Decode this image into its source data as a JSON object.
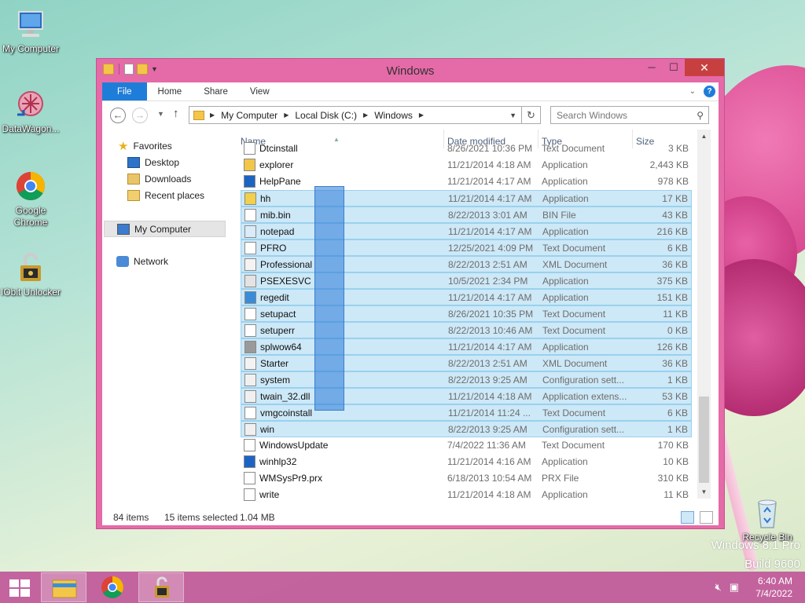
{
  "desktop": {
    "icons": [
      {
        "label": "My Computer",
        "icon": "computer-icon"
      },
      {
        "label": "DataWagon...",
        "icon": "datawagon-icon"
      },
      {
        "label": "Google Chrome",
        "icon": "chrome-icon"
      },
      {
        "label": "IObit Unlocker",
        "icon": "iobit-unlocker-icon"
      }
    ],
    "recycle_bin": "Recycle Bin",
    "watermark_line1": "Windows 8.1 Pro",
    "watermark_line2": "Build 9600"
  },
  "window": {
    "title": "Windows",
    "close_glyph": "✕",
    "minimize_glyph": "─",
    "maximize_glyph": "☐"
  },
  "ribbon": {
    "tabs": [
      "File",
      "Home",
      "Share",
      "View"
    ],
    "help": "?"
  },
  "address": {
    "crumbs": [
      "My Computer",
      "Local Disk (C:)",
      "Windows"
    ],
    "search_placeholder": "Search Windows"
  },
  "navpane": {
    "favorites": "Favorites",
    "desktop": "Desktop",
    "downloads": "Downloads",
    "recent": "Recent places",
    "computer": "My Computer",
    "network": "Network"
  },
  "columns": {
    "name": "Name",
    "date": "Date modified",
    "type": "Type",
    "size": "Size"
  },
  "files": [
    {
      "name": "Dtcinstall",
      "date": "8/26/2021 10:36 PM",
      "type": "Text Document",
      "size": "3 KB",
      "selected": false,
      "icon": "text-file-icon"
    },
    {
      "name": "explorer",
      "date": "11/21/2014 4:18 AM",
      "type": "Application",
      "size": "2,443 KB",
      "selected": false,
      "icon": "explorer-icon"
    },
    {
      "name": "HelpPane",
      "date": "11/21/2014 4:17 AM",
      "type": "Application",
      "size": "978 KB",
      "selected": false,
      "icon": "help-icon"
    },
    {
      "name": "hh",
      "date": "11/21/2014 4:17 AM",
      "type": "Application",
      "size": "17 KB",
      "selected": true,
      "icon": "help-book-icon"
    },
    {
      "name": "mib.bin",
      "date": "8/22/2013 3:01 AM",
      "type": "BIN File",
      "size": "43 KB",
      "selected": true,
      "icon": "file-icon"
    },
    {
      "name": "notepad",
      "date": "11/21/2014 4:17 AM",
      "type": "Application",
      "size": "216 KB",
      "selected": true,
      "icon": "notepad-icon"
    },
    {
      "name": "PFRO",
      "date": "12/25/2021 4:09 PM",
      "type": "Text Document",
      "size": "6 KB",
      "selected": true,
      "icon": "text-file-icon"
    },
    {
      "name": "Professional",
      "date": "8/22/2013 2:51 AM",
      "type": "XML Document",
      "size": "36 KB",
      "selected": true,
      "icon": "xml-file-icon"
    },
    {
      "name": "PSEXESVC",
      "date": "10/5/2021 2:34 PM",
      "type": "Application",
      "size": "375 KB",
      "selected": true,
      "icon": "app-icon"
    },
    {
      "name": "regedit",
      "date": "11/21/2014 4:17 AM",
      "type": "Application",
      "size": "151 KB",
      "selected": true,
      "icon": "regedit-icon"
    },
    {
      "name": "setupact",
      "date": "8/26/2021 10:35 PM",
      "type": "Text Document",
      "size": "11 KB",
      "selected": true,
      "icon": "text-file-icon"
    },
    {
      "name": "setuperr",
      "date": "8/22/2013 10:46 AM",
      "type": "Text Document",
      "size": "0 KB",
      "selected": true,
      "icon": "text-file-icon"
    },
    {
      "name": "splwow64",
      "date": "11/21/2014 4:17 AM",
      "type": "Application",
      "size": "126 KB",
      "selected": true,
      "icon": "printer-icon"
    },
    {
      "name": "Starter",
      "date": "8/22/2013 2:51 AM",
      "type": "XML Document",
      "size": "36 KB",
      "selected": true,
      "icon": "xml-file-icon"
    },
    {
      "name": "system",
      "date": "8/22/2013 9:25 AM",
      "type": "Configuration sett...",
      "size": "1 KB",
      "selected": true,
      "icon": "settings-file-icon"
    },
    {
      "name": "twain_32.dll",
      "date": "11/21/2014 4:18 AM",
      "type": "Application extens...",
      "size": "53 KB",
      "selected": true,
      "icon": "dll-file-icon"
    },
    {
      "name": "vmgcoinstall",
      "date": "11/21/2014 11:24 ...",
      "type": "Text Document",
      "size": "6 KB",
      "selected": true,
      "icon": "text-file-icon"
    },
    {
      "name": "win",
      "date": "8/22/2013 9:25 AM",
      "type": "Configuration sett...",
      "size": "1 KB",
      "selected": true,
      "icon": "settings-file-icon"
    },
    {
      "name": "WindowsUpdate",
      "date": "7/4/2022 11:36 AM",
      "type": "Text Document",
      "size": "170 KB",
      "selected": false,
      "icon": "text-file-icon"
    },
    {
      "name": "winhlp32",
      "date": "11/21/2014 4:16 AM",
      "type": "Application",
      "size": "10 KB",
      "selected": false,
      "icon": "help-icon"
    },
    {
      "name": "WMSysPr9.prx",
      "date": "6/18/2013 10:54 AM",
      "type": "PRX File",
      "size": "310 KB",
      "selected": false,
      "icon": "file-icon"
    },
    {
      "name": "write",
      "date": "11/21/2014 4:18 AM",
      "type": "Application",
      "size": "11 KB",
      "selected": false,
      "icon": "wordpad-icon"
    }
  ],
  "status": {
    "items": "84 items",
    "selected": "15 items selected",
    "size": "1.04 MB"
  },
  "taskbar": {
    "time": "6:40 AM",
    "date": "7/4/2022"
  },
  "colors": {
    "window_frame": "#e56aa8",
    "accent": "#1e7dd8",
    "selection": "#cde8f7"
  }
}
